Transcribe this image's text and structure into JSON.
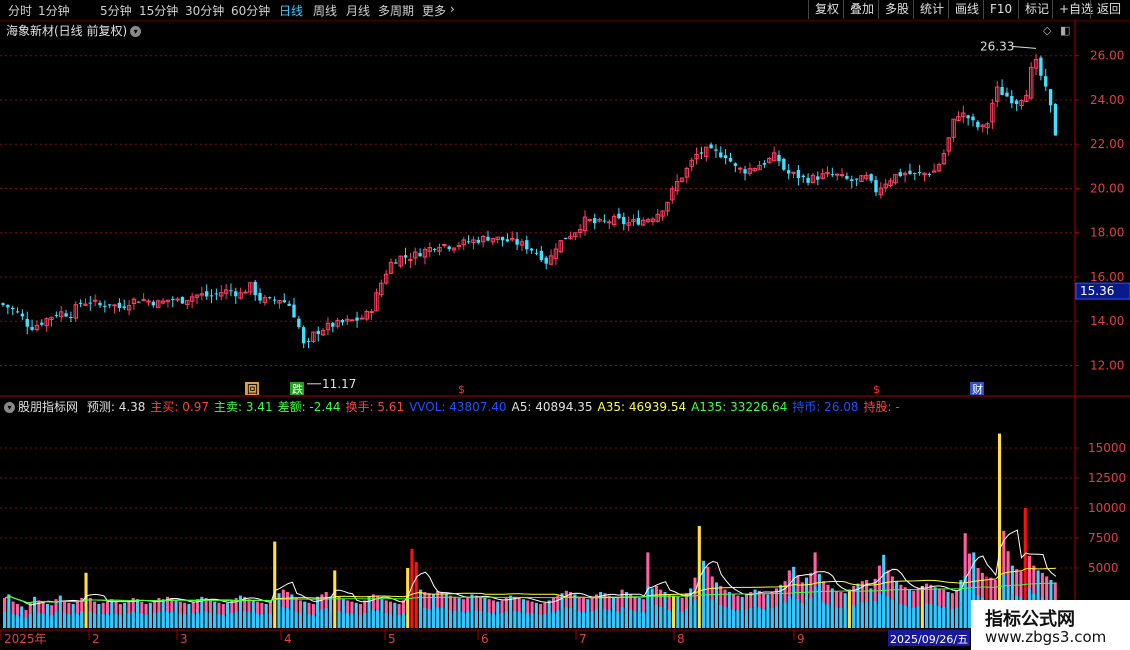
{
  "toolbar": {
    "periods": [
      "分时",
      "1分钟",
      "5分钟",
      "15分钟",
      "30分钟",
      "60分钟",
      "日线",
      "周线",
      "月线",
      "多周期",
      "更多"
    ],
    "active_period": "日线",
    "right_buttons": [
      "复权",
      "叠加",
      "多股",
      "统计",
      "画线",
      "F10",
      "标记",
      "+自选",
      "返回"
    ]
  },
  "stock_title": "海象新材(日线 前复权)",
  "indicator": {
    "name": "股朋指标网",
    "items": [
      {
        "label": "预测: 4.38",
        "color": "#e0e0e0"
      },
      {
        "label": "主买: 0.97",
        "color": "#ff4040"
      },
      {
        "label": "主卖: 3.41",
        "color": "#40ff40"
      },
      {
        "label": "差额: -2.44",
        "color": "#40ff40"
      },
      {
        "label": "换手: 5.61",
        "color": "#ff4040"
      },
      {
        "label": "VVOL: 43807.40",
        "color": "#2050ff"
      },
      {
        "label": "A5: 40894.35",
        "color": "#e0e0e0"
      },
      {
        "label": "A35: 46939.54",
        "color": "#ffff40"
      },
      {
        "label": "A135: 33226.64",
        "color": "#40ff40"
      },
      {
        "label": "持币: 26.08",
        "color": "#2050ff"
      },
      {
        "label": "持股: -",
        "color": "#ff4040"
      }
    ]
  },
  "chart_data": [
    {
      "type": "candlestick",
      "title": "海象新材(日线 前复权)",
      "ylim": [
        10.8,
        26.8
      ],
      "yticks": [
        "26.00",
        "24.00",
        "22.00",
        "20.00",
        "18.00",
        "16.00",
        "14.00",
        "12.00"
      ],
      "ytick_values": [
        26,
        24,
        22,
        20,
        18,
        16,
        14,
        12
      ],
      "current_price_label": "15.36",
      "current_price": 15.36,
      "high_label": "26.33",
      "low_label": "11.17",
      "close_path": [
        [
          0,
          14.8
        ],
        [
          10,
          14.6
        ],
        [
          20,
          14.3
        ],
        [
          30,
          13.7
        ],
        [
          40,
          13.9
        ],
        [
          50,
          14.2
        ],
        [
          60,
          14.4
        ],
        [
          70,
          14.3
        ],
        [
          80,
          14.8
        ],
        [
          90,
          14.9
        ],
        [
          100,
          14.7
        ],
        [
          110,
          14.8
        ],
        [
          120,
          14.6
        ],
        [
          130,
          14.9
        ],
        [
          140,
          15.0
        ],
        [
          150,
          14.9
        ],
        [
          160,
          14.8
        ],
        [
          170,
          15.0
        ],
        [
          180,
          14.9
        ],
        [
          190,
          15.1
        ],
        [
          200,
          15.2
        ],
        [
          210,
          15.1
        ],
        [
          220,
          15.3
        ],
        [
          230,
          15.4
        ],
        [
          240,
          15.2
        ],
        [
          250,
          15.6
        ],
        [
          260,
          15.0
        ],
        [
          270,
          14.9
        ],
        [
          280,
          15.0
        ],
        [
          290,
          14.7
        ],
        [
          296,
          14.1
        ],
        [
          302,
          13.3
        ],
        [
          306,
          12.4
        ],
        [
          310,
          13.3
        ],
        [
          320,
          13.6
        ],
        [
          330,
          13.8
        ],
        [
          340,
          13.9
        ],
        [
          350,
          14.0
        ],
        [
          360,
          14.1
        ],
        [
          370,
          14.4
        ],
        [
          380,
          15.6
        ],
        [
          390,
          16.6
        ],
        [
          400,
          16.9
        ],
        [
          410,
          16.9
        ],
        [
          420,
          17.1
        ],
        [
          430,
          17.3
        ],
        [
          440,
          17.5
        ],
        [
          450,
          17.4
        ],
        [
          460,
          17.5
        ],
        [
          470,
          17.6
        ],
        [
          480,
          17.7
        ],
        [
          490,
          17.8
        ],
        [
          500,
          17.7
        ],
        [
          510,
          17.6
        ],
        [
          520,
          17.5
        ],
        [
          530,
          17.3
        ],
        [
          540,
          17.0
        ],
        [
          548,
          16.6
        ],
        [
          556,
          17.4
        ],
        [
          566,
          17.8
        ],
        [
          576,
          18.1
        ],
        [
          586,
          18.6
        ],
        [
          596,
          18.4
        ],
        [
          606,
          18.5
        ],
        [
          616,
          18.6
        ],
        [
          626,
          18.4
        ],
        [
          636,
          18.5
        ],
        [
          646,
          18.6
        ],
        [
          656,
          18.8
        ],
        [
          666,
          19.3
        ],
        [
          676,
          20.2
        ],
        [
          686,
          20.8
        ],
        [
          696,
          21.5
        ],
        [
          706,
          21.7
        ],
        [
          716,
          21.6
        ],
        [
          726,
          21.5
        ],
        [
          736,
          20.9
        ],
        [
          746,
          20.8
        ],
        [
          756,
          21.0
        ],
        [
          766,
          21.2
        ],
        [
          776,
          21.5
        ],
        [
          786,
          20.7
        ],
        [
          796,
          20.6
        ],
        [
          806,
          20.4
        ],
        [
          816,
          20.5
        ],
        [
          826,
          20.6
        ],
        [
          836,
          20.6
        ],
        [
          846,
          20.4
        ],
        [
          856,
          20.3
        ],
        [
          866,
          20.5
        ],
        [
          876,
          19.9
        ],
        [
          886,
          20.3
        ],
        [
          896,
          20.6
        ],
        [
          906,
          20.7
        ],
        [
          916,
          20.6
        ],
        [
          926,
          20.7
        ],
        [
          936,
          20.8
        ],
        [
          946,
          21.8
        ],
        [
          956,
          23.4
        ],
        [
          966,
          23.3
        ],
        [
          976,
          22.8
        ],
        [
          986,
          22.7
        ],
        [
          996,
          24.5
        ],
        [
          1006,
          24.2
        ],
        [
          1016,
          23.9
        ],
        [
          1026,
          24.3
        ],
        [
          1034,
          25.9
        ],
        [
          1040,
          25.2
        ],
        [
          1046,
          24.4
        ],
        [
          1052,
          23.4
        ],
        [
          1058,
          21.8
        ]
      ],
      "annotations": [
        "回",
        "跌",
        "$",
        "$",
        "财"
      ]
    },
    {
      "type": "bar",
      "title": "股朋指标网",
      "ylim": [
        0,
        17500
      ],
      "yticks": [
        "15000",
        "12500",
        "10000",
        "7500",
        "5000"
      ],
      "ytick_values": [
        15000,
        12500,
        10000,
        7500,
        5000
      ],
      "x_labels": [
        "2025年",
        "2",
        "3",
        "4",
        "5",
        "6",
        "7",
        "8",
        "9",
        "2025/09/26/五"
      ],
      "volume_series": [
        2500,
        2800,
        2200,
        2000,
        1800,
        1500,
        2100,
        2600,
        2300,
        2200,
        2000,
        1900,
        2400,
        2700,
        2300,
        2100,
        2000,
        2200,
        2500,
        4600,
        2500,
        2200,
        2000,
        2100,
        2300,
        2400,
        2200,
        2000,
        2100,
        2300,
        2500,
        2400,
        2200,
        2000,
        2100,
        2300,
        2500,
        2400,
        2600,
        2500,
        2300,
        2200,
        2100,
        2000,
        2200,
        2400,
        2600,
        2500,
        2300,
        2200,
        2100,
        2000,
        2100,
        2300,
        2500,
        2700,
        2600,
        2400,
        2300,
        2200,
        2100,
        2000,
        2200,
        7200,
        2900,
        3200,
        3000,
        2800,
        2500,
        2300,
        2200,
        2100,
        2000,
        2600,
        2800,
        3000,
        2500,
        4800,
        2600,
        2400,
        2300,
        2200,
        2100,
        2000,
        2300,
        2600,
        2800,
        2700,
        2400,
        2300,
        2200,
        2100,
        2000,
        2300,
        5000,
        6600,
        5500,
        3200,
        3000,
        2900,
        2800,
        3100,
        3000,
        2900,
        2700,
        2600,
        2500,
        2400,
        2600,
        2800,
        2700,
        2600,
        2500,
        2400,
        2300,
        2200,
        2300,
        2500,
        2700,
        2600,
        2500,
        2400,
        2300,
        2200,
        2100,
        2000,
        2100,
        2300,
        2500,
        2700,
        2900,
        3100,
        3000,
        2800,
        2600,
        2500,
        2400,
        2600,
        2800,
        3000,
        2900,
        2700,
        2600,
        2500,
        3200,
        3000,
        2800,
        2600,
        2500,
        2400,
        6300,
        3300,
        3500,
        3200,
        3000,
        2800,
        2700,
        2600,
        2500,
        2900,
        3300,
        4200,
        8500,
        5600,
        5100,
        4300,
        3800,
        3500,
        3200,
        3000,
        2800,
        2700,
        2600,
        2800,
        3000,
        3200,
        3100,
        2900,
        2800,
        3000,
        3300,
        3600,
        3900,
        4800,
        5100,
        4400,
        3800,
        4200,
        4600,
        6300,
        4500,
        3900,
        3600,
        3300,
        3100,
        3000,
        2900,
        3200,
        3500,
        3700,
        3900,
        4000,
        3300,
        4100,
        5200,
        6100,
        4800,
        4300,
        3900,
        3600,
        3400,
        3200,
        3100,
        3300,
        3500,
        3700,
        3600,
        3400,
        3300,
        3200,
        3000,
        2900,
        3100,
        4000,
        7900,
        6200,
        6300,
        5000,
        4600,
        4300,
        4200,
        4000,
        16200,
        8100,
        6400,
        5200,
        4900,
        4700,
        10000,
        6000,
        5200,
        4800,
        4600,
        4300,
        4000,
        3800
      ]
    }
  ]
}
